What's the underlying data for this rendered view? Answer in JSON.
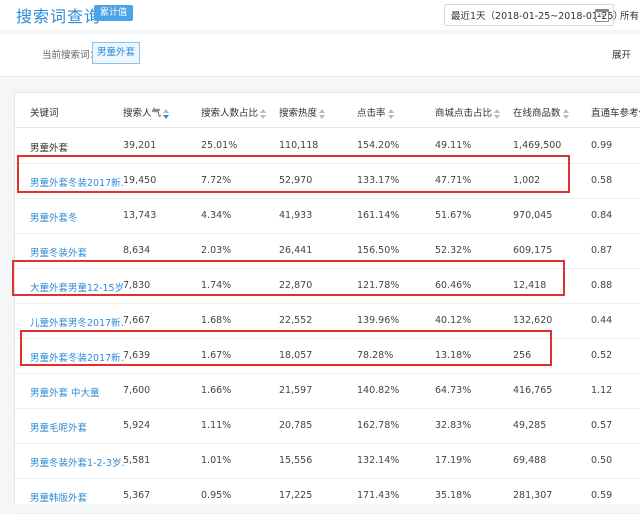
{
  "header": {
    "title": "搜索词查询",
    "badge": "累计值",
    "date_range": "最近1天（2018-01-25~2018-01-25）",
    "calendar_day": "25",
    "more_label": "所有"
  },
  "filter": {
    "label": "当前搜索词：",
    "tag": "男童外套",
    "expand_label": "展开"
  },
  "columns": [
    "关键词",
    "搜索人气",
    "搜索人数占比",
    "搜索热度",
    "点击率",
    "商城点击占比",
    "在线商品数",
    "直通车参考价"
  ],
  "rows": [
    {
      "keyword": "男童外套",
      "popularity": "39,201",
      "ratio": "25.01%",
      "heat": "110,118",
      "ctr": "154.20%",
      "mall_ratio": "49.11%",
      "products": "1,469,500",
      "ztc": "0.99",
      "link": false
    },
    {
      "keyword": "男童外套冬装2017新...",
      "popularity": "19,450",
      "ratio": "7.72%",
      "heat": "52,970",
      "ctr": "133.17%",
      "mall_ratio": "47.71%",
      "products": "1,002",
      "ztc": "0.58",
      "link": true
    },
    {
      "keyword": "男童外套冬",
      "popularity": "13,743",
      "ratio": "4.34%",
      "heat": "41,933",
      "ctr": "161.14%",
      "mall_ratio": "51.67%",
      "products": "970,045",
      "ztc": "0.84",
      "link": true
    },
    {
      "keyword": "男童冬装外套",
      "popularity": "8,634",
      "ratio": "2.03%",
      "heat": "26,441",
      "ctr": "156.50%",
      "mall_ratio": "52.32%",
      "products": "609,175",
      "ztc": "0.87",
      "link": true
    },
    {
      "keyword": "大童外套男童12-15岁...",
      "popularity": "7,830",
      "ratio": "1.74%",
      "heat": "22,870",
      "ctr": "121.78%",
      "mall_ratio": "60.46%",
      "products": "12,418",
      "ztc": "0.88",
      "link": true
    },
    {
      "keyword": "儿童外套男冬2017新...",
      "popularity": "7,667",
      "ratio": "1.68%",
      "heat": "22,552",
      "ctr": "139.96%",
      "mall_ratio": "40.12%",
      "products": "132,620",
      "ztc": "0.44",
      "link": true
    },
    {
      "keyword": "男童外套冬装2017新...",
      "popularity": "7,639",
      "ratio": "1.67%",
      "heat": "18,057",
      "ctr": "78.28%",
      "mall_ratio": "13.18%",
      "products": "256",
      "ztc": "0.52",
      "link": true
    },
    {
      "keyword": "男童外套 中大童",
      "popularity": "7,600",
      "ratio": "1.66%",
      "heat": "21,597",
      "ctr": "140.82%",
      "mall_ratio": "64.73%",
      "products": "416,765",
      "ztc": "1.12",
      "link": true
    },
    {
      "keyword": "男童毛呢外套",
      "popularity": "5,924",
      "ratio": "1.11%",
      "heat": "20,785",
      "ctr": "162.78%",
      "mall_ratio": "32.83%",
      "products": "49,285",
      "ztc": "0.57",
      "link": true
    },
    {
      "keyword": "男童冬装外套1-2-3岁...",
      "popularity": "5,581",
      "ratio": "1.01%",
      "heat": "15,556",
      "ctr": "132.14%",
      "mall_ratio": "17.19%",
      "products": "69,488",
      "ztc": "0.50",
      "link": true
    },
    {
      "keyword": "男童韩版外套",
      "popularity": "5,367",
      "ratio": "0.95%",
      "heat": "17,225",
      "ctr": "171.43%",
      "mall_ratio": "35.18%",
      "products": "281,307",
      "ztc": "0.59",
      "link": true
    }
  ],
  "highlight_colors": {
    "annotation": "#e0312d",
    "link": "#2d8cd6"
  }
}
